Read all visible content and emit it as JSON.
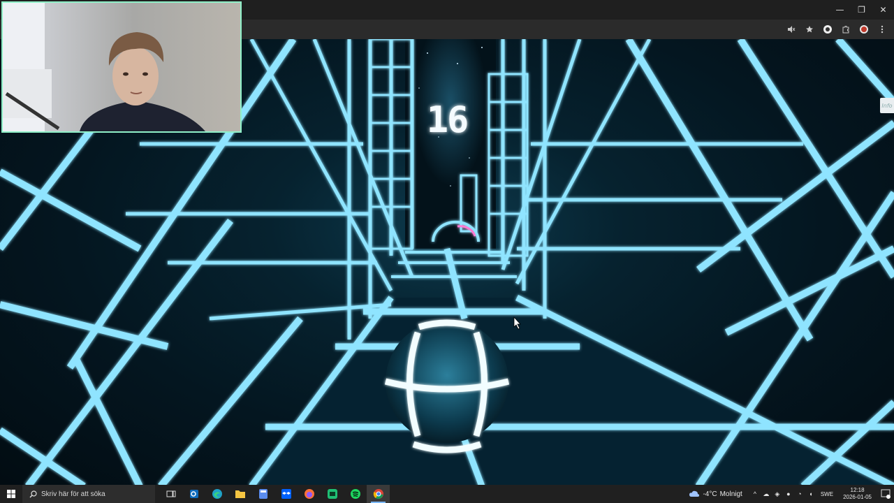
{
  "game": {
    "score": "16",
    "info_tab": "Info"
  },
  "window": {
    "minimize": "—",
    "restore": "❐",
    "close": "✕"
  },
  "taskbar": {
    "search_placeholder": "Skriv här för att söka",
    "apps": [
      "task-view",
      "outlook",
      "edge",
      "file-explorer",
      "calculator",
      "dropbox",
      "firefox",
      "terminal",
      "spotify",
      "chrome"
    ],
    "weather_temp": "-4°C",
    "weather_text": "Molnigt",
    "language": "SWE",
    "time": "12:18",
    "date": "2026-01-05"
  },
  "colors": {
    "grid": "#8fe4ff",
    "grid_glow": "#2bb6e6",
    "webcam_border": "#8ff0c8",
    "taskbar": "#202020"
  }
}
